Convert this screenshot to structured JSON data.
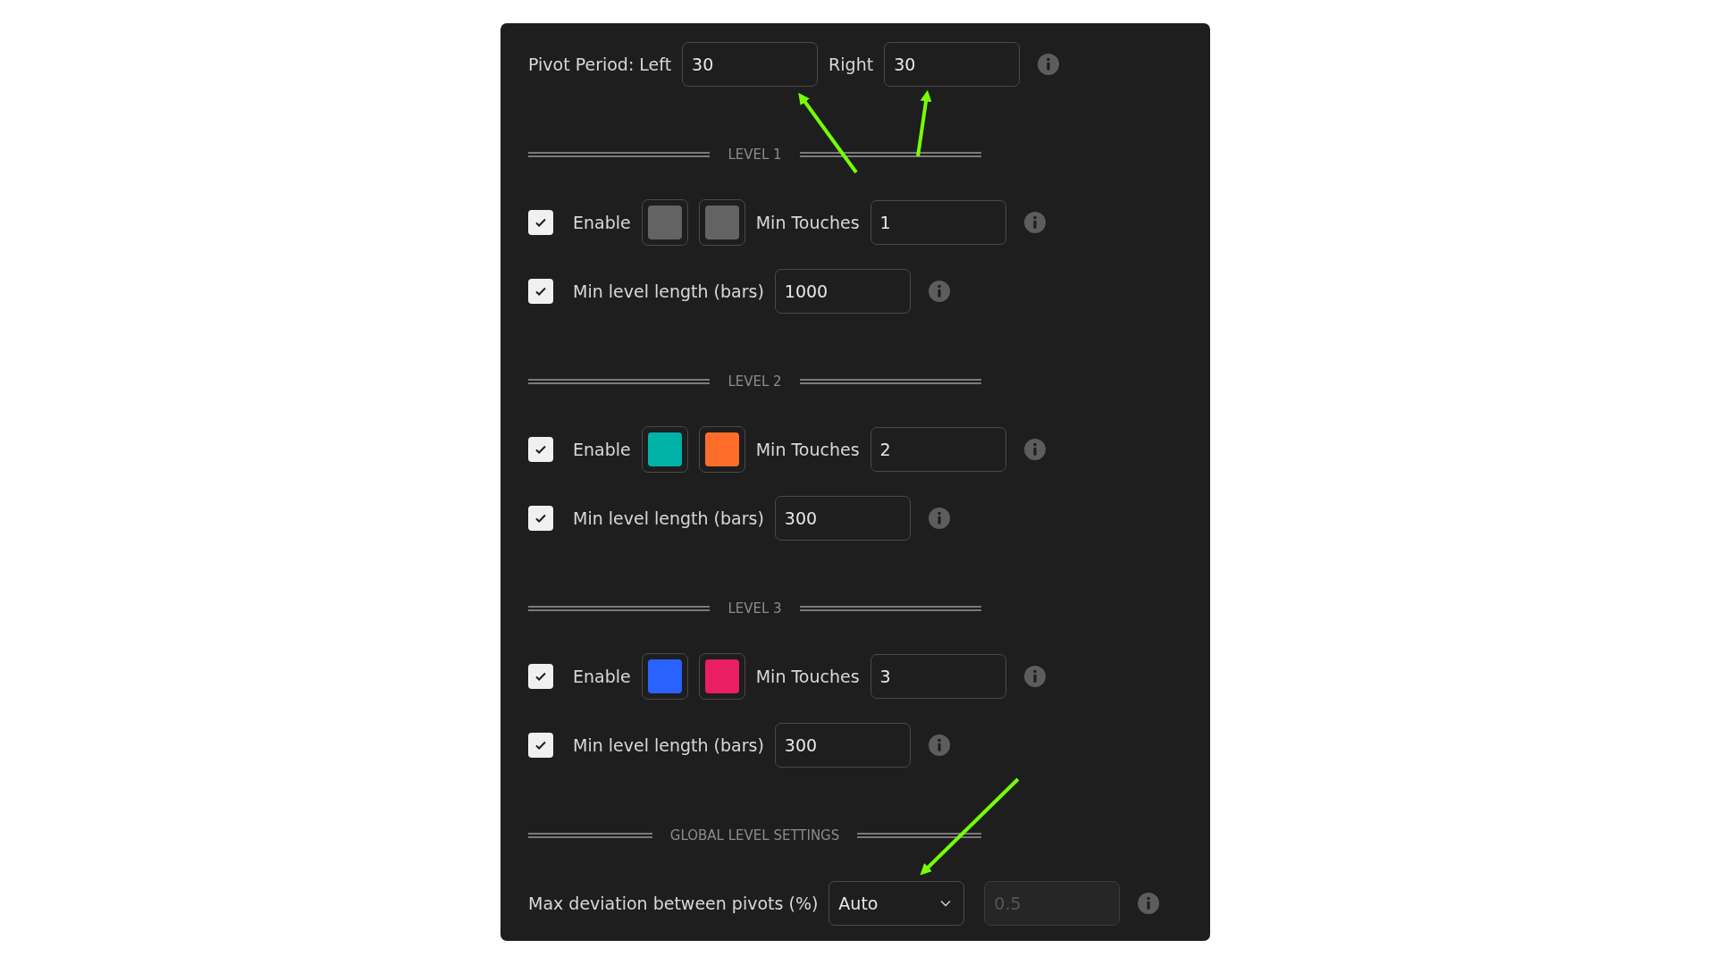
{
  "pivot_period": {
    "label": "Pivot Period: Left",
    "left_value": "30",
    "right_label": "Right",
    "right_value": "30"
  },
  "levels": [
    {
      "heading": "LEVEL 1",
      "enable": {
        "label": "Enable",
        "checked": true
      },
      "swatches": [
        {
          "color": "#636363"
        },
        {
          "color": "#636363"
        }
      ],
      "touches_label": "Min Touches",
      "touches_value": "1",
      "length": {
        "label": "Min level length (bars)",
        "checked": true,
        "value": "1000"
      }
    },
    {
      "heading": "LEVEL 2",
      "enable": {
        "label": "Enable",
        "checked": true
      },
      "swatches": [
        {
          "color": "#00b2a8"
        },
        {
          "color": "#ff6d2a"
        }
      ],
      "touches_label": "Min Touches",
      "touches_value": "2",
      "length": {
        "label": "Min level length (bars)",
        "checked": true,
        "value": "300"
      }
    },
    {
      "heading": "LEVEL 3",
      "enable": {
        "label": "Enable",
        "checked": true
      },
      "swatches": [
        {
          "color": "#2962ff"
        },
        {
          "color": "#e91e63"
        }
      ],
      "touches_label": "Min Touches",
      "touches_value": "3",
      "length": {
        "label": "Min level length (bars)",
        "checked": true,
        "value": "300"
      }
    }
  ],
  "global": {
    "heading": "GLOBAL LEVEL SETTINGS",
    "label": "Max deviation between pivots (%)",
    "mode": "Auto",
    "value": "0.5",
    "value_disabled": true
  }
}
